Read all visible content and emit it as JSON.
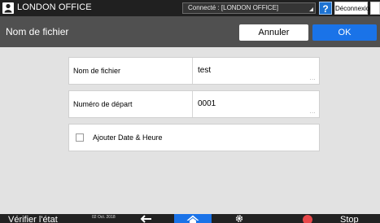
{
  "topbar": {
    "office": "LONDON OFFICE",
    "connection": "Connecté : [LONDON OFFICE]",
    "help": "?",
    "logout": "Déconnexion"
  },
  "titlebar": {
    "title": "Nom de fichier",
    "cancel": "Annuler",
    "ok": "OK"
  },
  "form": {
    "filename_label": "Nom de fichier",
    "filename_value": "test",
    "start_label": "Numéro de départ",
    "start_value": "0001",
    "more": "...",
    "date_checkbox_label": "Ajouter Date & Heure",
    "date_checked": false
  },
  "bottombar": {
    "check_status": "Vérifier l'état",
    "date": "02 Oct. 2018",
    "stop": "Stop"
  },
  "colors": {
    "accent": "#1a73e8",
    "stop": "#e8484a"
  }
}
